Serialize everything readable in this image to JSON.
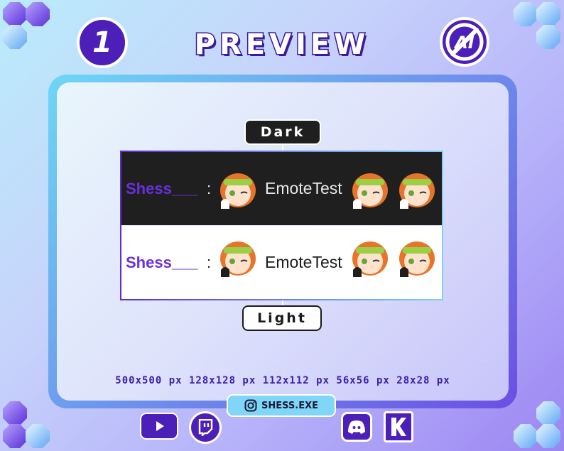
{
  "header": {
    "step_number": "1",
    "title": "PREVIEW",
    "no_ai_badge_text": "AI"
  },
  "preview": {
    "dark_label": "Dark",
    "light_label": "Light",
    "rows": [
      {
        "theme": "dark",
        "username": "Shess___",
        "separator": ":",
        "message": "EmoteTest"
      },
      {
        "theme": "light",
        "username": "Shess___",
        "separator": ":",
        "message": "EmoteTest"
      }
    ]
  },
  "sizes_text": "500x500 px 128x128 px 112x112 px 56x56 px 28x28 px",
  "social": {
    "handle": "SHESS.EXE",
    "icons": [
      "youtube-icon",
      "twitch-icon",
      "instagram-icon",
      "discord-icon",
      "kofi-icon"
    ]
  },
  "colors": {
    "accent_purple": "#4b1fb8",
    "username_purple": "#6b2ee0",
    "dark_bg": "#1f1f20",
    "light_bg": "#ffffff",
    "handle_bg": "#7fd6f7"
  }
}
